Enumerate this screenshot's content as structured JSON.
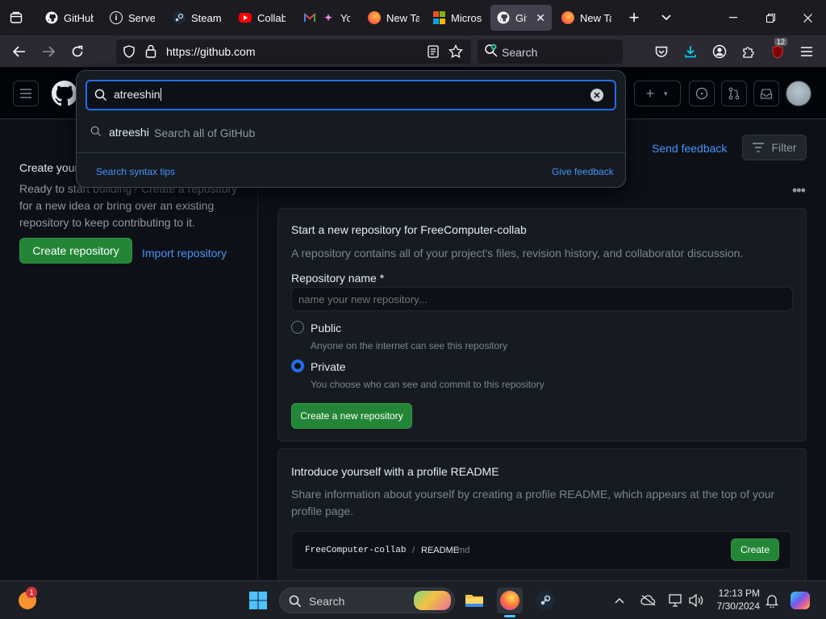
{
  "browser": {
    "tabs": [
      {
        "title": "GitHub",
        "favicon": "github-icon"
      },
      {
        "title": "Server",
        "favicon": "info-icon"
      },
      {
        "title": "Steam",
        "favicon": "steam-icon"
      },
      {
        "title": "Collab",
        "favicon": "youtube-icon"
      },
      {
        "title": "You",
        "favicon": "gmail-icon"
      },
      {
        "title": "New Tab",
        "favicon": "firefox-icon"
      },
      {
        "title": "Micros",
        "favicon": "microsoft-icon"
      },
      {
        "title": "GitHub",
        "favicon": "github-icon",
        "active": true
      },
      {
        "title": "New Tab",
        "favicon": "firefox-icon"
      }
    ],
    "url": "https://github.com",
    "search_placeholder": "Search",
    "extensions_badge": "12"
  },
  "search_overlay": {
    "query": "atreeshin",
    "suggestion_term": "atreeshi",
    "suggestion_action": "Search all of GitHub",
    "syntax_tips": "Search syntax tips",
    "give_feedback": "Give feedback"
  },
  "header": {
    "send_feedback": "Send feedback",
    "filter": "Filter"
  },
  "left_panel": {
    "heading": "Create your first project",
    "description": "Ready to start building? Create a repository for a new idea or bring over an existing repository to keep contributing to it.",
    "create_button": "Create repository",
    "import_link": "Import repository"
  },
  "new_repo_card": {
    "title": "Start a new repository for FreeComputer-collab",
    "subtitle": "A repository contains all of your project's files, revision history, and collaborator discussion.",
    "name_label": "Repository name *",
    "name_placeholder": "name your new repository...",
    "public_label": "Public",
    "public_desc": "Anyone on the internet can see this repository",
    "private_label": "Private",
    "private_desc": "You choose who can see and commit to this repository",
    "selected_visibility": "Private",
    "create_button": "Create a new repository"
  },
  "readme_card": {
    "title": "Introduce yourself with a profile README",
    "description": "Share information about yourself by creating a profile README, which appears at the top of your profile page.",
    "path_owner": "FreeComputer-collab",
    "path_sep": "/",
    "path_file": "README",
    "path_ext": ".md",
    "create_button": "Create"
  },
  "taskbar": {
    "search_label": "Search",
    "time": "12:13 PM",
    "date": "7/30/2024",
    "notification_badge": "1"
  },
  "colors": {
    "accent_blue": "#1f6feb",
    "link_blue": "#4493f8",
    "button_green": "#238636"
  }
}
